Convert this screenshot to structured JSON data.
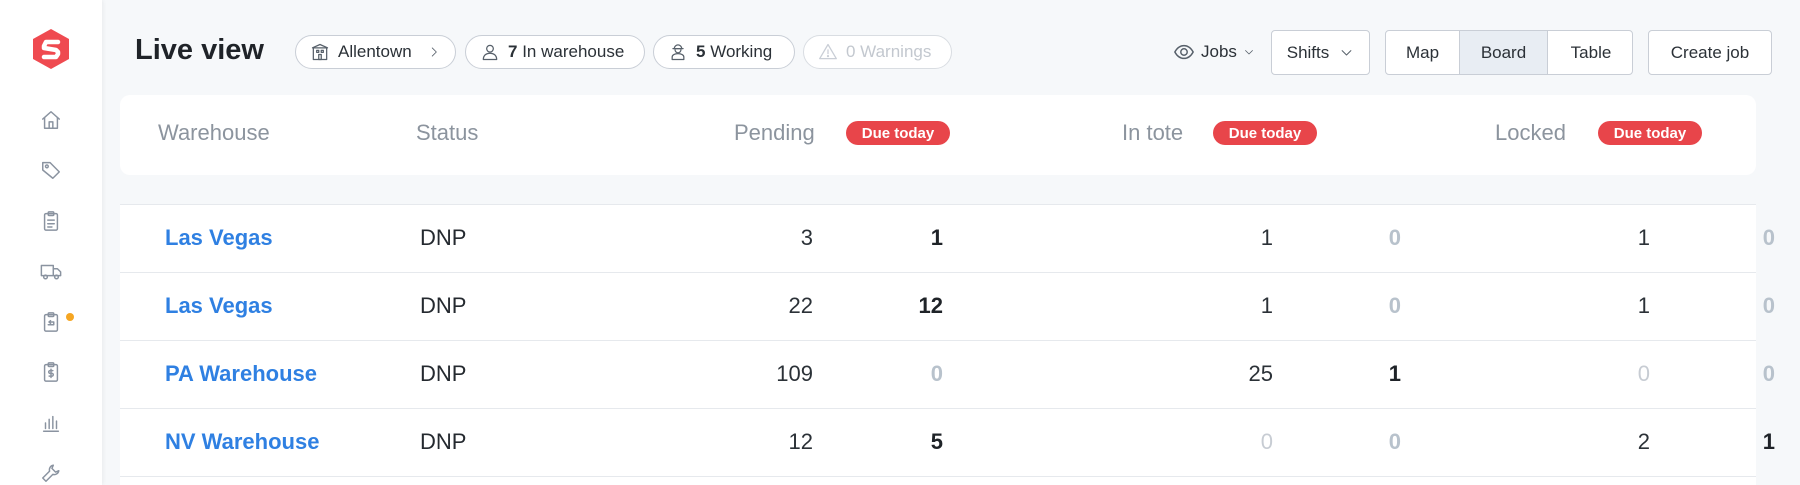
{
  "colors": {
    "accent": "#2f80e2",
    "badge": "#e8454a",
    "logo": "#ef4a50",
    "notification": "#f5a623"
  },
  "sidebar": {
    "items": [
      {
        "icon": "home-icon"
      },
      {
        "icon": "tag-icon"
      },
      {
        "icon": "clipboard-icon"
      },
      {
        "icon": "truck-icon"
      },
      {
        "icon": "clipboard-return-icon",
        "notification": true
      },
      {
        "icon": "clipboard-dollar-icon"
      },
      {
        "icon": "bar-chart-icon"
      },
      {
        "icon": "wrench-icon"
      }
    ]
  },
  "header": {
    "title": "Live view",
    "location": "Allentown",
    "in_warehouse": {
      "count": "7",
      "label": "In warehouse"
    },
    "working": {
      "count": "5",
      "label": "Working"
    },
    "warnings": "0 Warnings",
    "jobs_menu": "Jobs",
    "shifts": "Shifts",
    "views": [
      "Map",
      "Board",
      "Table"
    ],
    "active_view": "Board",
    "create_job": "Create job"
  },
  "table": {
    "columns": {
      "warehouse": "Warehouse",
      "status": "Status",
      "pending": "Pending",
      "in_tote": "In tote",
      "locked": "Locked",
      "due_today": "Due today"
    },
    "rows": [
      {
        "warehouse": "Las Vegas",
        "status": "DNP",
        "pending": "3",
        "pending_due": "1",
        "in_tote": "1",
        "in_tote_due": "0",
        "locked": "1",
        "locked_due": "0"
      },
      {
        "warehouse": "Las Vegas",
        "status": "DNP",
        "pending": "22",
        "pending_due": "12",
        "in_tote": "1",
        "in_tote_due": "0",
        "locked": "1",
        "locked_due": "0"
      },
      {
        "warehouse": "PA Warehouse",
        "status": "DNP",
        "pending": "109",
        "pending_due": "0",
        "in_tote": "25",
        "in_tote_due": "1",
        "locked": "0",
        "locked_due": "0"
      },
      {
        "warehouse": "NV Warehouse",
        "status": "DNP",
        "pending": "12",
        "pending_due": "5",
        "in_tote": "0",
        "in_tote_due": "0",
        "locked": "2",
        "locked_due": "1"
      }
    ]
  }
}
